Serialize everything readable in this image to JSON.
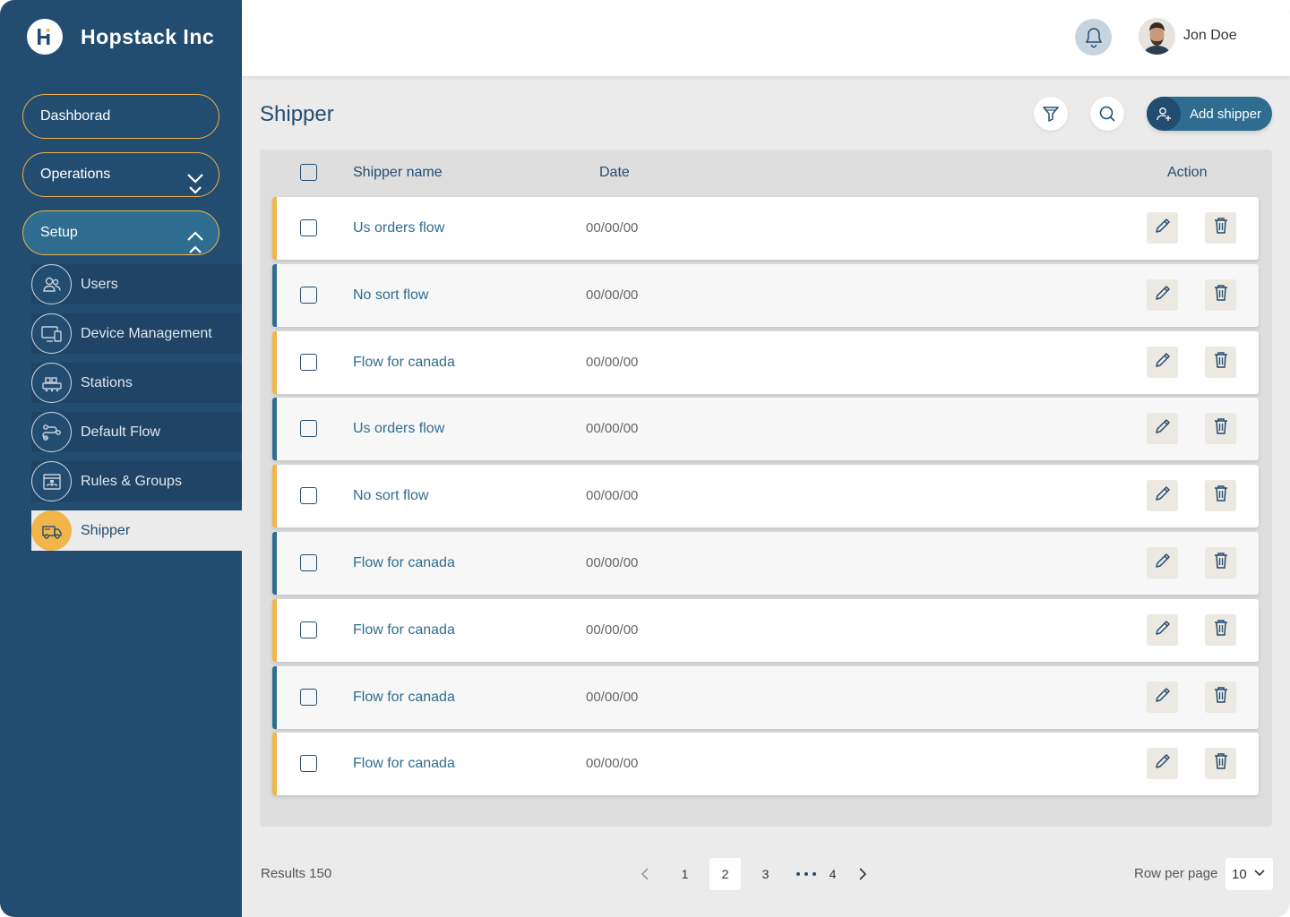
{
  "brand": {
    "name": "Hopstack Inc",
    "logo_letter": "H"
  },
  "header": {
    "user_name": "Jon Doe",
    "bell_icon": "bell-icon"
  },
  "sidebar": {
    "main_items": [
      {
        "label": "Dashborad"
      },
      {
        "label": "Operations"
      },
      {
        "label": "Setup"
      }
    ],
    "sub_items": [
      {
        "label": "Users",
        "icon": "users-icon"
      },
      {
        "label": "Device Management",
        "icon": "devices-icon"
      },
      {
        "label": "Stations",
        "icon": "stations-icon"
      },
      {
        "label": "Default Flow",
        "icon": "flow-icon"
      },
      {
        "label": "Rules & Groups",
        "icon": "rules-icon"
      },
      {
        "label": "Shipper",
        "icon": "truck-icon"
      }
    ]
  },
  "page": {
    "title": "Shipper",
    "add_button": "Add shipper"
  },
  "table": {
    "columns": {
      "name": "Shipper name",
      "date": "Date",
      "action": "Action"
    },
    "rows": [
      {
        "name": "Us orders flow",
        "date": "00/00/00"
      },
      {
        "name": "No sort flow",
        "date": "00/00/00"
      },
      {
        "name": "Flow for canada",
        "date": "00/00/00"
      },
      {
        "name": "Us orders flow",
        "date": "00/00/00"
      },
      {
        "name": "No sort flow",
        "date": "00/00/00"
      },
      {
        "name": "Flow for canada",
        "date": "00/00/00"
      },
      {
        "name": "Flow for canada",
        "date": "00/00/00"
      },
      {
        "name": "Flow for canada",
        "date": "00/00/00"
      },
      {
        "name": "Flow for canada",
        "date": "00/00/00"
      }
    ]
  },
  "footer": {
    "results": "Results 150",
    "pages": [
      "1",
      "2",
      "3",
      "4"
    ],
    "current_page": "2",
    "rows_per_page_label": "Row per page",
    "rows_per_page_value": "10"
  },
  "colors": {
    "sidebar": "#234d70",
    "accent": "#f2b54a",
    "primary": "#2e6d90"
  }
}
